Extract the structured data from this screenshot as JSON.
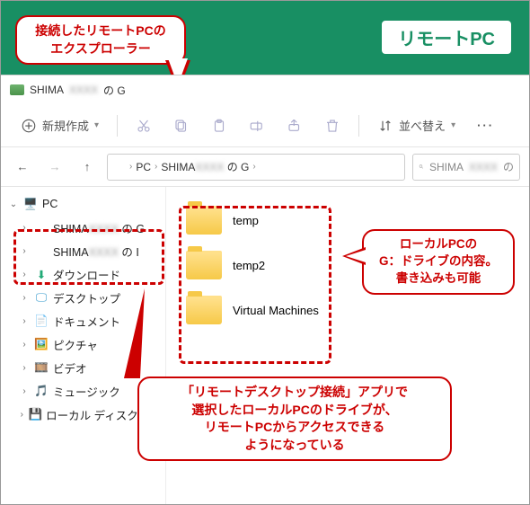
{
  "annotations": {
    "top_left_line1": "接続したリモートPCの",
    "top_left_line2": "エクスプローラー",
    "top_right_label": "リモートPC",
    "mid_right_line1": "ローカルPCの",
    "mid_right_line2": "G：ドライブの内容。",
    "mid_right_line3": "書き込みも可能",
    "bottom_line1": "「リモートデスクトップ接続」アプリで",
    "bottom_line2": "選択したローカルPCのドライブが、",
    "bottom_line3": "リモートPCからアクセスできる",
    "bottom_line4": "ようになっている"
  },
  "window": {
    "title_prefix": "SHIMA",
    "title_blur": "XXXX",
    "title_suffix": " の G"
  },
  "toolbar": {
    "new_label": "新規作成",
    "sort_label": "並べ替え"
  },
  "breadcrumb": {
    "root": "PC",
    "seg_prefix": "SHIMA",
    "seg_blur": "XXXX",
    "seg_suffix": " の G"
  },
  "search": {
    "prefix": "SHIMA",
    "blur": "XXXX",
    "suffix": " の"
  },
  "navpane": {
    "pc": "PC",
    "remote_g_prefix": "SHIMA",
    "remote_g_blur": "XXXX",
    "remote_g_suffix": " の G",
    "remote_i_prefix": "SHIMA",
    "remote_i_blur": "XXXX",
    "remote_i_suffix": " の I",
    "downloads": "ダウンロード",
    "desktop": "デスクトップ",
    "documents": "ドキュメント",
    "pictures": "ピクチャ",
    "videos": "ビデオ",
    "music": "ミュージック",
    "local_disk": "ローカル ディスク (C:)"
  },
  "content": {
    "items": [
      {
        "name": "temp"
      },
      {
        "name": "temp2"
      },
      {
        "name": "Virtual Machines"
      }
    ]
  }
}
